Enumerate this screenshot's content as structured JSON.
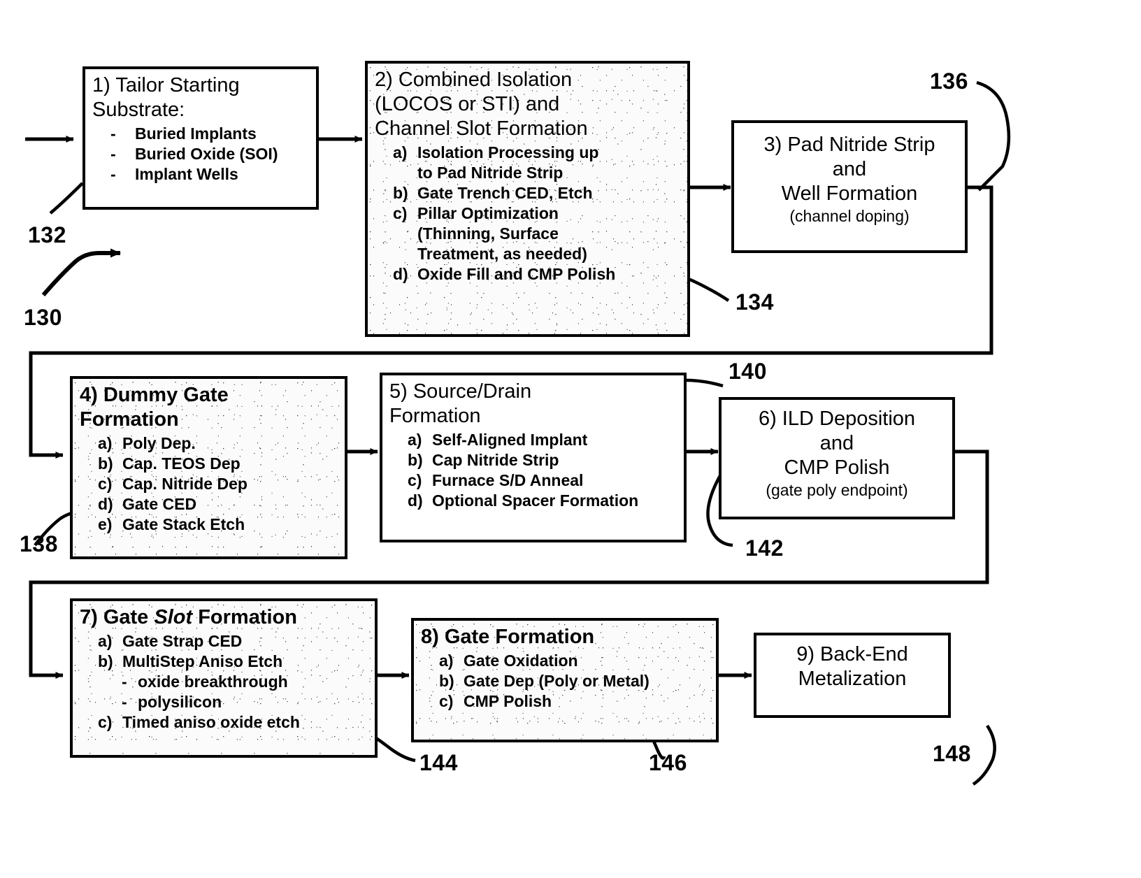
{
  "figure": {
    "type": "process-flow-diagram",
    "overall_ref": "130"
  },
  "boxes": [
    {
      "id": "box1",
      "ref": "132",
      "title": "1) Tailor Starting\nSubstrate:",
      "bold": false,
      "shaded": false,
      "steps": [
        {
          "label": "-",
          "text": "Buried Implants"
        },
        {
          "label": "-",
          "text": "Buried Oxide (SOI)"
        },
        {
          "label": "-",
          "text": "Implant Wells"
        }
      ]
    },
    {
      "id": "box2",
      "ref": "134",
      "title": "2) Combined Isolation\n(LOCOS or STI) and\nChannel Slot Formation",
      "bold": false,
      "shaded": true,
      "steps": [
        {
          "label": "a)",
          "text": "Isolation Processing up\nto Pad Nitride Strip"
        },
        {
          "label": "b)",
          "text": "Gate Trench CED, Etch"
        },
        {
          "label": "c)",
          "text": "Pillar Optimization\n(Thinning,  Surface\n Treatment,  as needed)"
        },
        {
          "label": "d)",
          "text": "Oxide Fill and CMP Polish"
        }
      ]
    },
    {
      "id": "box3",
      "ref": "136",
      "title": "3) Pad Nitride Strip\nand\nWell Formation",
      "subnote": "(channel doping)",
      "bold": false,
      "shaded": false,
      "steps": []
    },
    {
      "id": "box4",
      "ref": "138",
      "title": "4) Dummy Gate\n     Formation",
      "bold": true,
      "shaded": true,
      "steps": [
        {
          "label": "a)",
          "text": "Poly Dep."
        },
        {
          "label": "b)",
          "text": "Cap. TEOS Dep"
        },
        {
          "label": "c)",
          "text": "Cap. Nitride Dep"
        },
        {
          "label": "d)",
          "text": "Gate CED"
        },
        {
          "label": "e)",
          "text": "Gate Stack Etch"
        }
      ]
    },
    {
      "id": "box5",
      "ref": "140",
      "title": "5) Source/Drain\n     Formation",
      "bold": false,
      "shaded": false,
      "steps": [
        {
          "label": "a)",
          "text": "Self-Aligned Implant"
        },
        {
          "label": "b)",
          "text": "Cap Nitride Strip"
        },
        {
          "label": "c)",
          "text": "Furnace S/D Anneal"
        },
        {
          "label": "d)",
          "text": "Optional Spacer Formation"
        }
      ]
    },
    {
      "id": "box6",
      "ref": "142",
      "title": "6)  ILD Deposition\nand\nCMP Polish",
      "subnote": "(gate poly endpoint)",
      "bold": false,
      "shaded": false,
      "steps": []
    },
    {
      "id": "box7",
      "ref": "144",
      "title_pre": "7)  Gate ",
      "title_italic": "Slot",
      "title_post": " Formation",
      "bold": true,
      "shaded": true,
      "steps": [
        {
          "label": "a)",
          "text": "Gate Strap CED"
        },
        {
          "label": "b)",
          "text": "MultiStep Aniso Etch"
        },
        {
          "label": "-",
          "text": "oxide breakthrough",
          "sub": true
        },
        {
          "label": "-",
          "text": "polysilicon",
          "sub": true
        },
        {
          "label": "c)",
          "text": "Timed aniso oxide etch"
        }
      ]
    },
    {
      "id": "box8",
      "ref": "146",
      "title": "8)  Gate Formation",
      "bold": true,
      "shaded": true,
      "steps": [
        {
          "label": "a)",
          "text": "Gate Oxidation"
        },
        {
          "label": "b)",
          "text": "Gate Dep (Poly or Metal)"
        },
        {
          "label": "c)",
          "text": "CMP Polish"
        }
      ]
    },
    {
      "id": "box9",
      "ref": "148",
      "title": "9) Back-End\n  Metalization",
      "bold": false,
      "shaded": false,
      "steps": []
    }
  ],
  "ref_labels": {
    "r130": "130",
    "r132": "132",
    "r134": "134",
    "r136": "136",
    "r138": "138",
    "r140": "140",
    "r142": "142",
    "r144": "144",
    "r146": "146",
    "r148": "148"
  },
  "colors": {
    "line": "#000000",
    "background": "#ffffff"
  }
}
